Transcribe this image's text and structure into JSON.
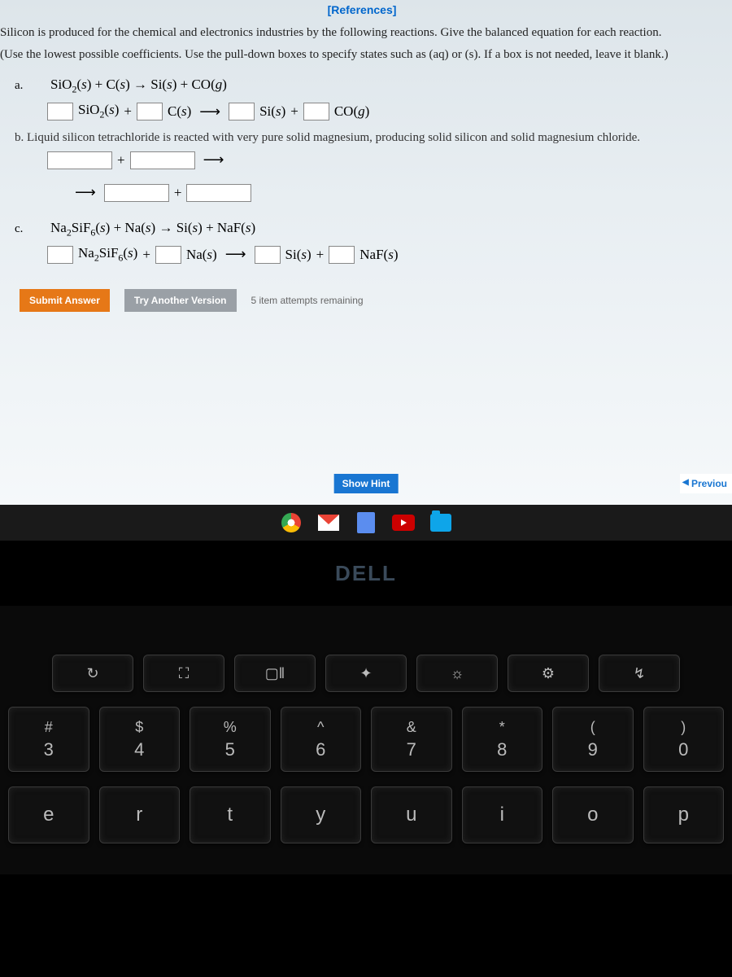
{
  "references_link": "[References]",
  "intro": "Silicon is produced for the chemical and electronics industries by the following reactions. Give the balanced equation for each reaction.",
  "instruct": "(Use the lowest possible coefficients. Use the pull-down boxes to specify states such as (aq) or (s). If a box is not needed, leave it blank.)",
  "a": {
    "label": "a.",
    "given": "SiO₂(s) + C(s) → Si(s) + CO(g)",
    "terms": [
      "SiO₂(s)",
      "+",
      "C(s)",
      "→",
      "Si(s)",
      "+",
      "CO(g)"
    ]
  },
  "b": {
    "label": "b.",
    "text": "Liquid silicon tetrachloride is reacted with very pure solid magnesium, producing solid silicon and solid magnesium chloride."
  },
  "c": {
    "label": "c.",
    "given": "Na₂SiF₆(s) + Na(s) → Si(s) + NaF(s)",
    "terms": [
      "Na₂SiF₆(s)",
      "+",
      "Na(s)",
      "→",
      "Si(s)",
      "+",
      "NaF(s)"
    ]
  },
  "buttons": {
    "submit": "Submit Answer",
    "try": "Try Another Version",
    "attempts": "5 item attempts remaining",
    "hint": "Show Hint",
    "prev": "Previou"
  },
  "dell": "DELL",
  "keyboard": {
    "fn": [
      "↻",
      "⛶",
      "▢‖",
      "✦",
      "☼",
      "⚙",
      "↯"
    ],
    "num": [
      {
        "sym": "#",
        "n": "3"
      },
      {
        "sym": "$",
        "n": "4"
      },
      {
        "sym": "%",
        "n": "5"
      },
      {
        "sym": "^",
        "n": "6"
      },
      {
        "sym": "&",
        "n": "7"
      },
      {
        "sym": "*",
        "n": "8"
      },
      {
        "sym": "(",
        "n": "9"
      },
      {
        "sym": ")",
        "n": "0"
      }
    ],
    "letters": [
      "e",
      "r",
      "t",
      "y",
      "u",
      "i",
      "o",
      "p"
    ]
  }
}
